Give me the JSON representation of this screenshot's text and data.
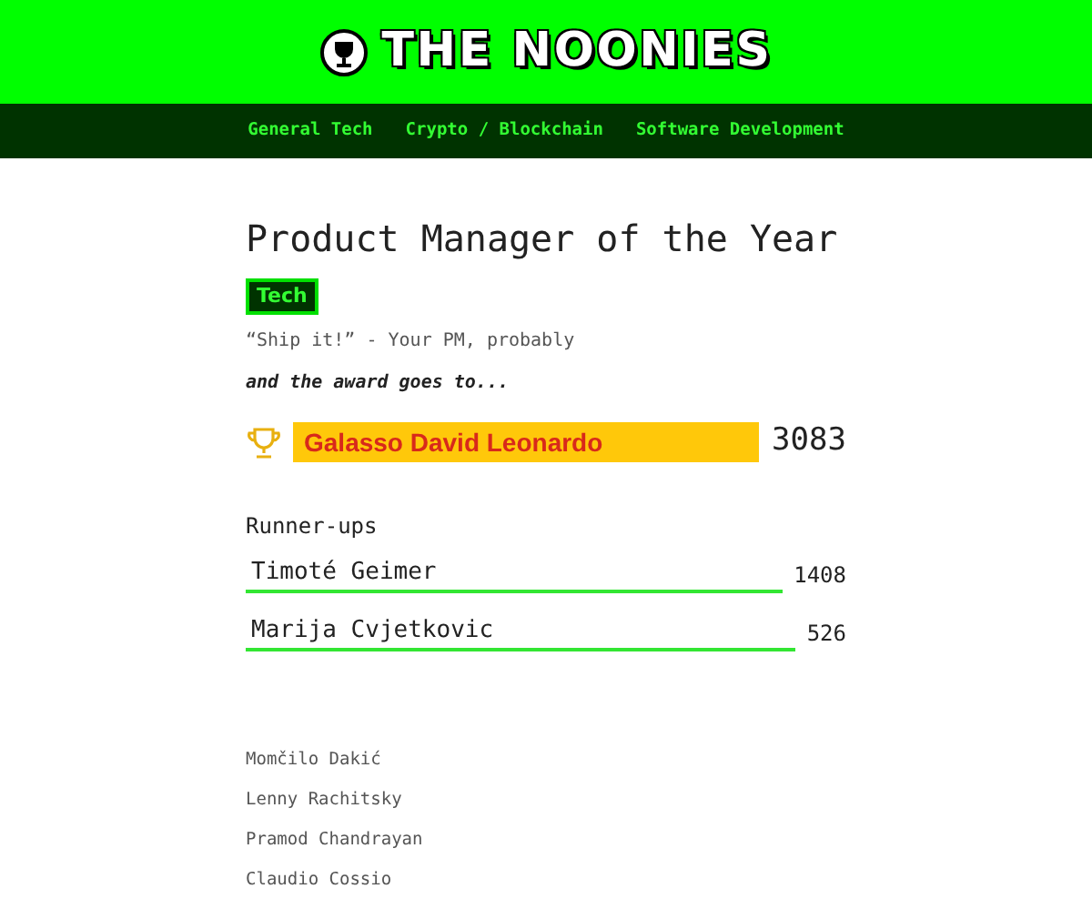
{
  "header": {
    "logo_text": "THE NOONIES"
  },
  "nav": {
    "items": [
      "General Tech",
      "Crypto / Blockchain",
      "Software Development"
    ]
  },
  "award": {
    "title": "Product Manager of the Year",
    "tag": "Tech",
    "quote": "“Ship it!” - Your PM, probably",
    "intro": "and the award goes to...",
    "winner": {
      "name": "Galasso David Leonardo",
      "votes": "3083"
    }
  },
  "runner_ups": {
    "heading": "Runner-ups",
    "items": [
      {
        "name": "Timoté Geimer",
        "votes": "1408"
      },
      {
        "name": "Marija Cvjetkovic",
        "votes": "526"
      }
    ]
  },
  "nominees": [
    "Momčilo Dakić",
    "Lenny Rachitsky",
    "Pramod Chandrayan",
    "Claudio Cossio"
  ]
}
